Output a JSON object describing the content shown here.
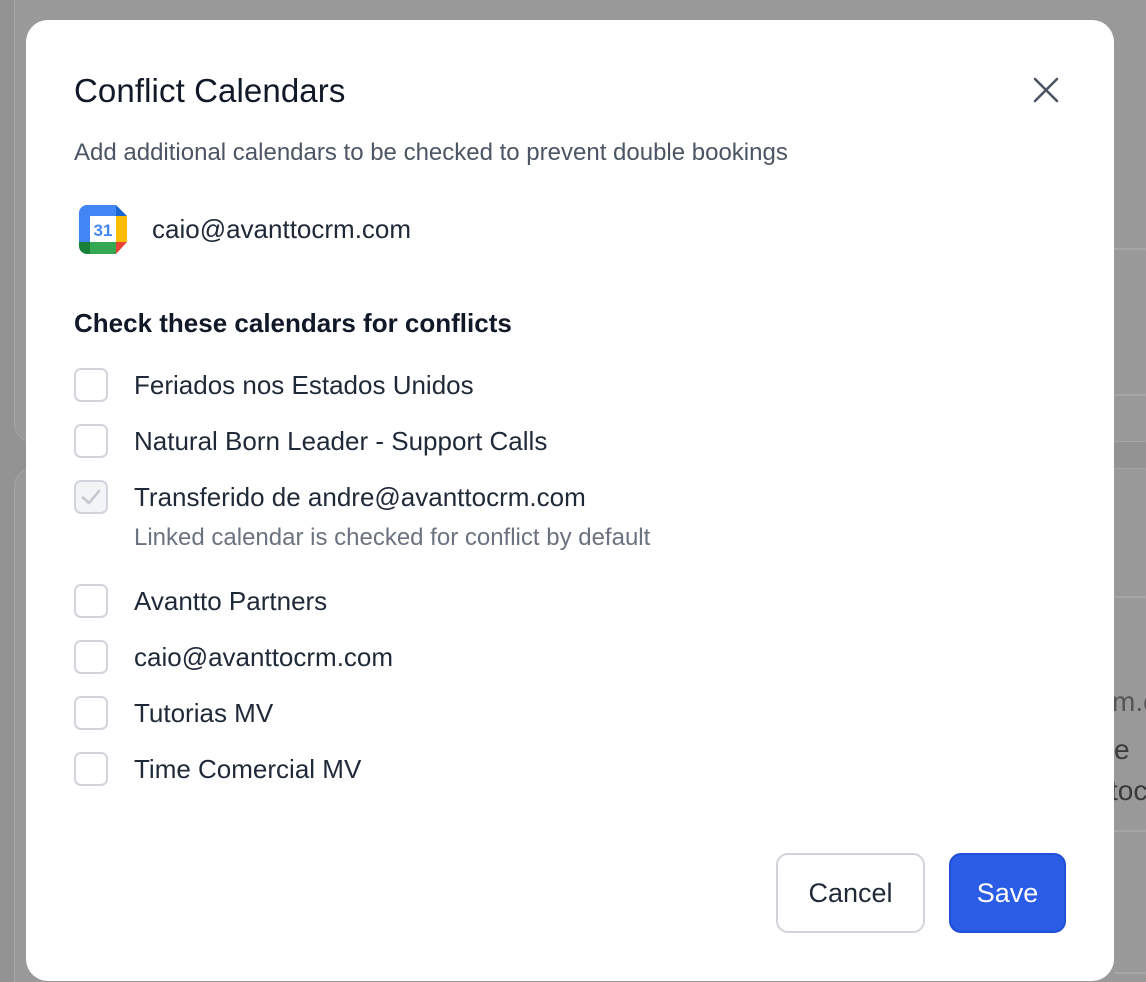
{
  "modal": {
    "title": "Conflict Calendars",
    "subtitle": "Add additional calendars to be checked to prevent double bookings",
    "account": {
      "icon": "google-calendar-icon",
      "icon_day": "31",
      "email": "caio@avanttocrm.com"
    },
    "section_heading": "Check these calendars for conflicts",
    "calendars": [
      {
        "label": "Feriados nos Estados Unidos",
        "checked": false,
        "disabled": false
      },
      {
        "label": "Natural Born Leader - Support Calls",
        "checked": false,
        "disabled": false
      },
      {
        "label": "Transferido de andre@avanttocrm.com",
        "checked": true,
        "disabled": true,
        "note": "Linked calendar is checked for conflict by default"
      },
      {
        "label": "Avantto Partners",
        "checked": false,
        "disabled": false
      },
      {
        "label": "caio@avanttocrm.com",
        "checked": false,
        "disabled": false
      },
      {
        "label": "Tutorias MV",
        "checked": false,
        "disabled": false
      },
      {
        "label": "Time Comercial MV",
        "checked": false,
        "disabled": false
      }
    ],
    "buttons": {
      "cancel": "Cancel",
      "save": "Save"
    }
  },
  "background": {
    "fragments": [
      "m.c",
      "e",
      "toc"
    ]
  },
  "colors": {
    "primary": "#2b5ce6",
    "overlay": "#939393",
    "text_primary": "#111827",
    "text_muted": "#6b7280"
  }
}
